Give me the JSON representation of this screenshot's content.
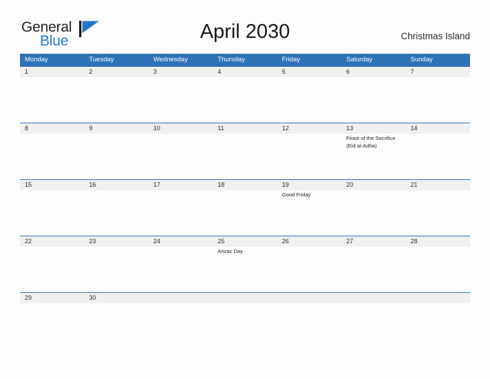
{
  "brand": {
    "name_part1": "General",
    "name_part2": "Blue",
    "flag_icon": "blue-flag-logo-icon",
    "color_dark": "#231f20",
    "color_blue": "#2277c8"
  },
  "header": {
    "title": "April 2030",
    "location": "Christmas Island"
  },
  "theme": {
    "header_blue": "#2e72b8",
    "date_band_gray": "#f0f0f0",
    "page_background": "#fdfdfd",
    "text_dark": "#2b2b2b"
  },
  "calendar": {
    "weekdays": [
      "Monday",
      "Tuesday",
      "Wednesday",
      "Thursday",
      "Friday",
      "Saturday",
      "Sunday"
    ],
    "weeks": [
      {
        "days": [
          {
            "date": "1",
            "event": ""
          },
          {
            "date": "2",
            "event": ""
          },
          {
            "date": "3",
            "event": ""
          },
          {
            "date": "4",
            "event": ""
          },
          {
            "date": "5",
            "event": ""
          },
          {
            "date": "6",
            "event": ""
          },
          {
            "date": "7",
            "event": ""
          }
        ]
      },
      {
        "days": [
          {
            "date": "8",
            "event": ""
          },
          {
            "date": "9",
            "event": ""
          },
          {
            "date": "10",
            "event": ""
          },
          {
            "date": "11",
            "event": ""
          },
          {
            "date": "12",
            "event": ""
          },
          {
            "date": "13",
            "event": "Feast of the Sacrifice (Eid al-Adha)"
          },
          {
            "date": "14",
            "event": ""
          }
        ]
      },
      {
        "days": [
          {
            "date": "15",
            "event": ""
          },
          {
            "date": "16",
            "event": ""
          },
          {
            "date": "17",
            "event": ""
          },
          {
            "date": "18",
            "event": ""
          },
          {
            "date": "19",
            "event": "Good Friday"
          },
          {
            "date": "20",
            "event": ""
          },
          {
            "date": "21",
            "event": ""
          }
        ]
      },
      {
        "days": [
          {
            "date": "22",
            "event": ""
          },
          {
            "date": "23",
            "event": ""
          },
          {
            "date": "24",
            "event": ""
          },
          {
            "date": "25",
            "event": "Anzac Day"
          },
          {
            "date": "26",
            "event": ""
          },
          {
            "date": "27",
            "event": ""
          },
          {
            "date": "28",
            "event": ""
          }
        ]
      },
      {
        "days": [
          {
            "date": "29",
            "event": ""
          },
          {
            "date": "30",
            "event": ""
          },
          {
            "date": "",
            "event": ""
          },
          {
            "date": "",
            "event": ""
          },
          {
            "date": "",
            "event": ""
          },
          {
            "date": "",
            "event": ""
          },
          {
            "date": "",
            "event": ""
          }
        ]
      }
    ]
  }
}
